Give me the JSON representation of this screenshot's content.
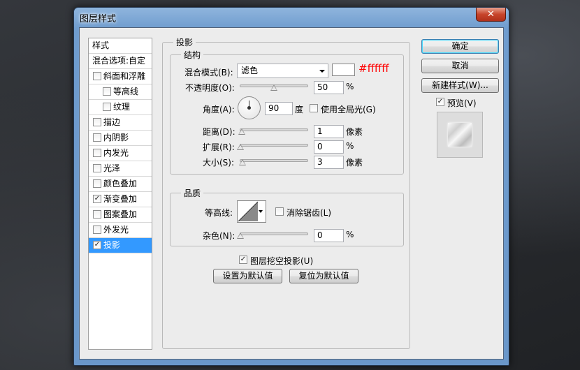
{
  "window": {
    "title": "图层样式",
    "close_glyph": "✕"
  },
  "style_list": {
    "header": "样式",
    "blend_options": "混合选项:自定",
    "items": [
      {
        "label": "斜面和浮雕",
        "checked": false,
        "indent": false
      },
      {
        "label": "等高线",
        "checked": false,
        "indent": true
      },
      {
        "label": "纹理",
        "checked": false,
        "indent": true
      },
      {
        "label": "描边",
        "checked": false,
        "indent": false
      },
      {
        "label": "内阴影",
        "checked": false,
        "indent": false
      },
      {
        "label": "内发光",
        "checked": false,
        "indent": false
      },
      {
        "label": "光泽",
        "checked": false,
        "indent": false
      },
      {
        "label": "颜色叠加",
        "checked": false,
        "indent": false
      },
      {
        "label": "渐变叠加",
        "checked": true,
        "indent": false
      },
      {
        "label": "图案叠加",
        "checked": false,
        "indent": false
      },
      {
        "label": "外发光",
        "checked": false,
        "indent": false
      },
      {
        "label": "投影",
        "checked": true,
        "indent": false,
        "selected": true
      }
    ]
  },
  "panel": {
    "title": "投影",
    "structure": {
      "title": "结构",
      "blend_mode_label": "混合模式(B):",
      "blend_mode_value": "滤色",
      "color_swatch": "#ffffff",
      "color_annotation": "#ffffff",
      "opacity_label": "不透明度(O):",
      "opacity_value": "50",
      "opacity_unit": "%",
      "angle_label": "角度(A):",
      "angle_value": "90",
      "angle_unit": "度",
      "global_light_label": "使用全局光(G)",
      "global_light_checked": false,
      "distance_label": "距离(D):",
      "distance_value": "1",
      "distance_unit": "像素",
      "spread_label": "扩展(R):",
      "spread_value": "0",
      "spread_unit": "%",
      "size_label": "大小(S):",
      "size_value": "3",
      "size_unit": "像素"
    },
    "quality": {
      "title": "品质",
      "contour_label": "等高线:",
      "anti_alias_label": "消除锯齿(L)",
      "anti_alias_checked": false,
      "noise_label": "杂色(N):",
      "noise_value": "0",
      "noise_unit": "%"
    },
    "knockout_label": "图层挖空投影(U)",
    "knockout_checked": true,
    "make_default": "设置为默认值",
    "reset_default": "复位为默认值"
  },
  "buttons": {
    "ok": "确定",
    "cancel": "取消",
    "new_style": "新建样式(W)...",
    "preview_label": "预览(V)",
    "preview_checked": true
  },
  "colors": {
    "annotation_red": "#ff0000",
    "selection": "#3399ff"
  },
  "check_glyph": "✓"
}
